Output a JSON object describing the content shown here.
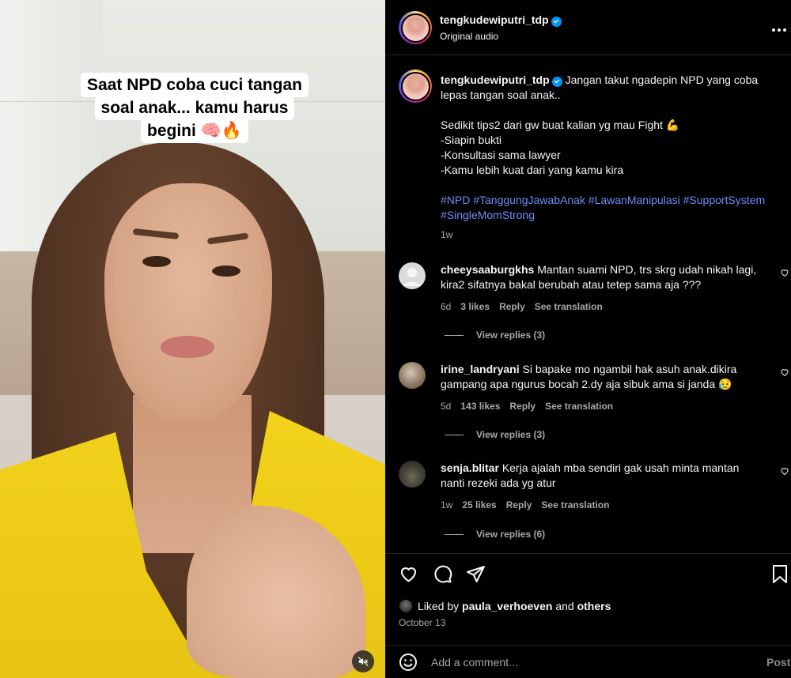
{
  "video": {
    "caption_lines": [
      "Saat NPD coba cuci tangan",
      "soal anak... kamu harus",
      "begini 🧠🔥"
    ],
    "mute_icon": "speaker-muted-icon"
  },
  "header": {
    "username": "tengkudewiputri_tdp",
    "audio": "Original audio",
    "more_icon": "ellipsis-icon"
  },
  "post_caption": {
    "username": "tengkudewiputri_tdp",
    "lines": [
      "Jangan takut ngadepin NPD yang coba",
      "lepas tangan soal anak..",
      "",
      "Sedikit tips2 dari gw buat kalian yg mau Fight 💪",
      "-Siapin bukti",
      "-Konsultasi sama lawyer",
      "-Kamu lebih kuat dari yang kamu kira",
      ""
    ],
    "hashtag_lines": [
      "#NPD #TanggungJawabAnak #LawanManipulasi #SupportSystem",
      "#SingleMomStrong"
    ],
    "time": "1w"
  },
  "comments": [
    {
      "username": "cheeysaaburgkhs",
      "lines": [
        "Mantan suami NPD, trs skrg udah nikah lagi,",
        "kira2 sifatnya bakal berubah atau tetep sama aja ???"
      ],
      "time": "6d",
      "likes": "3 likes",
      "reply": "Reply",
      "translate": "See translation",
      "view_replies": "View replies (3)"
    },
    {
      "username": "irine_landryani",
      "lines": [
        "Si bapake mo ngambil hak asuh anak.dikira",
        "gampang apa ngurus bocah 2.dy aja sibuk ama si janda 😥"
      ],
      "time": "5d",
      "likes": "143 likes",
      "reply": "Reply",
      "translate": "See translation",
      "view_replies": "View replies (3)"
    },
    {
      "username": "senja.blitar",
      "lines": [
        "Kerja ajalah mba sendiri gak usah minta mantan",
        "nanti rezeki ada yg atur"
      ],
      "time": "1w",
      "likes": "25 likes",
      "reply": "Reply",
      "translate": "See translation",
      "view_replies": "View replies (6)"
    }
  ],
  "actions": {
    "icons": [
      "heart-icon",
      "comment-icon",
      "share-icon",
      "bookmark-icon"
    ],
    "liked_prefix": "Liked by",
    "liked_user": "paula_verhoeven",
    "liked_and": "and",
    "liked_others": "others",
    "date": "October 13"
  },
  "comment_input": {
    "placeholder": "Add a comment...",
    "post_label": "Post"
  },
  "colors": {
    "background": "#000000",
    "hashtag": "#6f8ef7",
    "verified": "#0095f6",
    "muted_text": "#a8a8a8",
    "shirt": "#f2d21b"
  }
}
